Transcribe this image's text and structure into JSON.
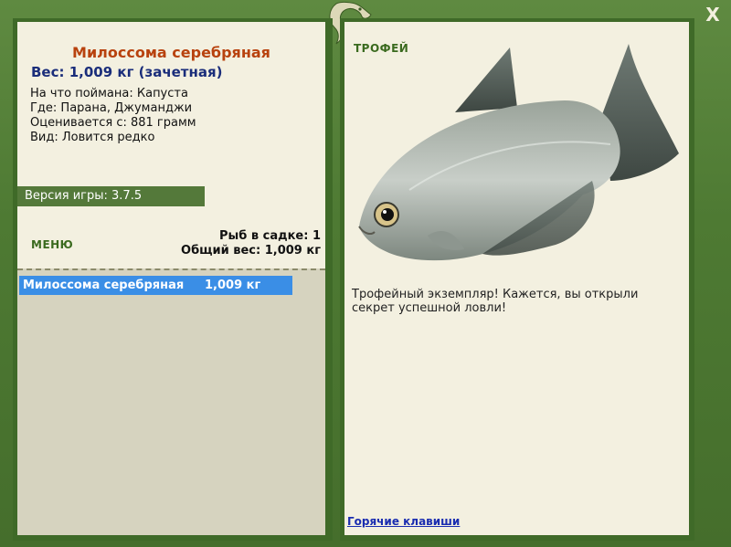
{
  "window": {
    "close_label": "X"
  },
  "fish": {
    "title": "Милоссома серебряная",
    "weight_line": "Вес: 1,009 кг (зачетная)",
    "details": [
      "На что поймана: Капуста",
      "Где: Парана, Джуманджи",
      "Оценивается с: 881 грамм",
      "Вид: Ловится редко"
    ]
  },
  "version": "Версия игры: 3.7.5",
  "menu_label": "МЕНЮ",
  "keep": {
    "count_line": "Рыб в садке: 1",
    "total_line": "Общий вес: 1,009 кг"
  },
  "catch_list": [
    {
      "name": "Милоссома серебряная",
      "weight": "1,009 кг"
    }
  ],
  "trophy": {
    "label": "ТРОФЕЙ",
    "text": "Трофейный экземпляр! Кажется, вы открыли секрет успешной ловли!"
  },
  "hotkeys_link": "Горячие клавиши",
  "colors": {
    "frame": "#4e7a33",
    "panel": "#f3f0e0",
    "title": "#b8420e",
    "weight": "#1a2d7a",
    "selection": "#3a8ee6"
  },
  "icons": [
    "lizard-logo-icon",
    "close-icon"
  ]
}
